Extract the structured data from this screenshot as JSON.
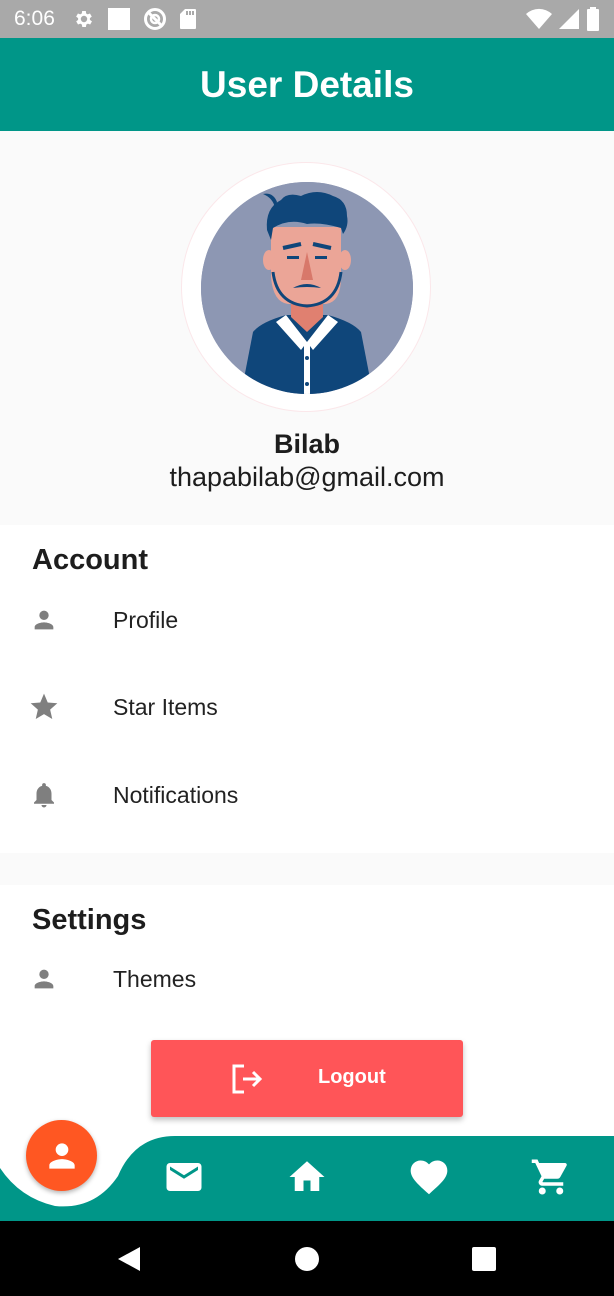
{
  "status_bar": {
    "time": "6:06",
    "left_icons": [
      "settings-icon",
      "square-icon",
      "no-disturb-icon",
      "sd-card-icon"
    ],
    "right_icons": [
      "wifi-icon",
      "signal-icon",
      "battery-icon"
    ]
  },
  "app_bar": {
    "title": "User Details"
  },
  "profile": {
    "name": "Bilab",
    "email": "thapabilab@gmail.com",
    "avatar_icon": "avatar-illustration"
  },
  "account": {
    "title": "Account",
    "items": [
      {
        "label": "Profile",
        "icon": "person-icon"
      },
      {
        "label": "Star Items",
        "icon": "star-icon"
      },
      {
        "label": "Notifications",
        "icon": "bell-icon"
      }
    ]
  },
  "settings": {
    "title": "Settings",
    "items": [
      {
        "label": "Themes",
        "icon": "person-icon"
      }
    ]
  },
  "logout": {
    "label": "Logout",
    "icon": "logout-icon"
  },
  "bottom_nav": {
    "active": "person-icon",
    "items": [
      "mail-icon",
      "home-icon",
      "heart-icon",
      "cart-icon"
    ]
  },
  "colors": {
    "primary": "#009688",
    "accent": "#ff5722",
    "logout": "#ff5558",
    "icon_gray": "#808080"
  }
}
